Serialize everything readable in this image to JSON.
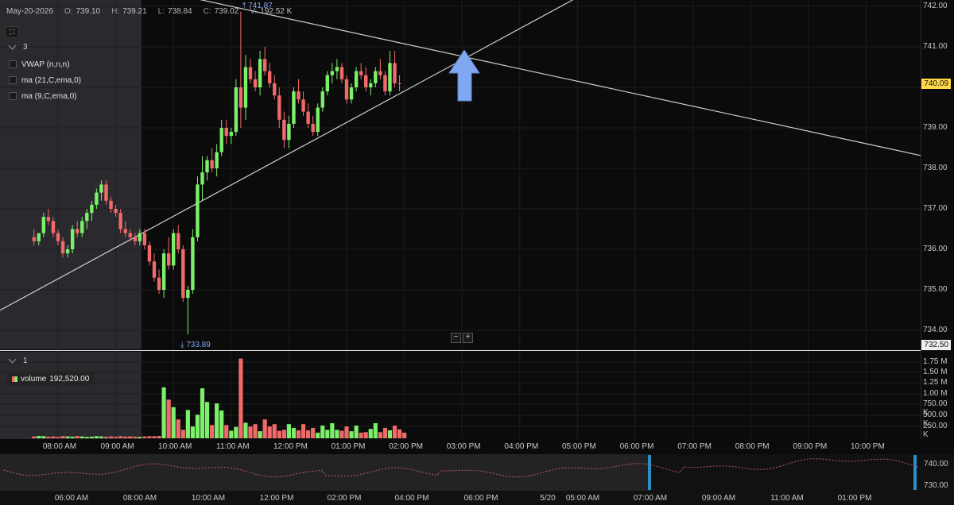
{
  "colors": {
    "up": "#7cf06a",
    "down": "#f06a6a",
    "grid": "#1d1d1d",
    "bg": "#0b0b0b",
    "premarket": "#2a2a2e",
    "arrow": "#7fa8f0",
    "current_price_bg": "#ffd84a"
  },
  "ohlc": {
    "date": "May-20-2026",
    "open_label": "O:",
    "open": "739.10",
    "high_label": "H:",
    "high": "739.21",
    "low_label": "L:",
    "low": "738.84",
    "close_label": "C:",
    "close": "739.02",
    "vol_label": "V:",
    "vol": "192.52 K"
  },
  "main_panel": {
    "collapse_count": "3",
    "indicators": [
      "VWAP (n,n,n)",
      "ma (21,C,ema,0)",
      "ma (9,C,ema,0)"
    ],
    "focus_icon": "fullscreen-icon"
  },
  "volume_panel": {
    "collapse_count": "1",
    "badge_label": "volume",
    "badge_value": "192,520.00"
  },
  "markers": {
    "high": "741.87",
    "low": "733.89"
  },
  "price_axis": {
    "labels": [
      "742.00",
      "741.00",
      "740.00",
      "739.00",
      "738.00",
      "737.00",
      "736.00",
      "735.00",
      "734.00"
    ],
    "current": "740.09",
    "bottom": "732.50"
  },
  "volume_axis": {
    "labels": [
      "1.75 M",
      "1.50 M",
      "1.25 M",
      "1.00 M",
      "750.00 K",
      "500.00 K",
      "250.00 K"
    ]
  },
  "time_axis": {
    "labels": [
      "08:00 AM",
      "09:00 AM",
      "10:00 AM",
      "11:00 AM",
      "12:00 PM",
      "01:00 PM",
      "02:00 PM",
      "03:00 PM",
      "04:00 PM",
      "05:00 PM",
      "06:00 PM",
      "07:00 PM",
      "08:00 PM",
      "09:00 PM",
      "10:00 PM"
    ]
  },
  "navigator": {
    "time_labels": [
      "06:00 AM",
      "08:00 AM",
      "10:00 AM",
      "12:00 PM",
      "02:00 PM",
      "04:00 PM",
      "06:00 PM",
      "5/20",
      "05:00 AM",
      "07:00 AM",
      "09:00 AM",
      "11:00 AM",
      "01:00 PM"
    ],
    "price_labels": [
      "740.00",
      "730.00"
    ]
  },
  "zoom": {
    "minus": "−",
    "plus": "+"
  },
  "chart_data": {
    "type": "candlestick",
    "session_date": "May-20-2026",
    "ylim": [
      733.5,
      742.2
    ],
    "x_range": [
      "07:35 AM",
      "11:00 PM"
    ],
    "bar_interval_minutes": 5,
    "start_time": "07:35 AM",
    "trendlines": [
      {
        "from": {
          "time": "07:35 AM",
          "price": 734.95
        },
        "to": {
          "time": "03:25 PM",
          "price": 741.0
        }
      },
      {
        "from": {
          "time": "11:00 AM",
          "price": 742.0
        },
        "to": {
          "time": "11:00 PM",
          "price": 738.3
        }
      }
    ],
    "candles": [
      [
        736.3,
        736.5,
        736.1,
        736.2
      ],
      [
        736.2,
        736.4,
        736.1,
        736.4
      ],
      [
        736.4,
        736.9,
        736.3,
        736.8
      ],
      [
        736.8,
        737.0,
        736.6,
        736.7
      ],
      [
        736.7,
        736.8,
        736.3,
        736.4
      ],
      [
        736.4,
        736.5,
        736.1,
        736.2
      ],
      [
        736.2,
        736.3,
        735.8,
        735.9
      ],
      [
        735.9,
        736.1,
        735.8,
        736.0
      ],
      [
        736.0,
        736.6,
        735.9,
        736.5
      ],
      [
        736.5,
        736.7,
        736.3,
        736.4
      ],
      [
        736.4,
        736.8,
        736.3,
        736.7
      ],
      [
        736.7,
        737.0,
        736.5,
        736.9
      ],
      [
        736.9,
        737.2,
        736.7,
        737.1
      ],
      [
        737.1,
        737.5,
        737.0,
        737.4
      ],
      [
        737.4,
        737.7,
        737.2,
        737.6
      ],
      [
        737.6,
        737.7,
        737.1,
        737.2
      ],
      [
        737.2,
        737.3,
        736.9,
        737.0
      ],
      [
        737.0,
        737.1,
        736.8,
        736.9
      ],
      [
        736.9,
        737.0,
        736.4,
        736.5
      ],
      [
        736.5,
        736.7,
        736.3,
        736.4
      ],
      [
        736.4,
        736.5,
        736.2,
        736.3
      ],
      [
        736.3,
        736.4,
        736.1,
        736.2
      ],
      [
        736.2,
        736.5,
        736.1,
        736.4
      ],
      [
        736.4,
        736.5,
        736.0,
        736.1
      ],
      [
        736.1,
        736.2,
        735.6,
        735.7
      ],
      [
        735.7,
        735.9,
        735.2,
        735.3
      ],
      [
        735.3,
        735.5,
        734.9,
        735.0
      ],
      [
        735.0,
        736.0,
        734.8,
        735.9
      ],
      [
        735.9,
        736.3,
        735.5,
        735.6
      ],
      [
        735.6,
        736.5,
        735.5,
        736.4
      ],
      [
        736.4,
        736.6,
        735.9,
        736.0
      ],
      [
        736.0,
        736.1,
        734.7,
        734.8
      ],
      [
        734.8,
        735.1,
        733.9,
        735.0
      ],
      [
        735.0,
        736.5,
        734.9,
        736.3
      ],
      [
        736.3,
        737.8,
        736.2,
        737.6
      ],
      [
        737.6,
        738.3,
        737.2,
        737.9
      ],
      [
        737.9,
        738.3,
        737.7,
        738.2
      ],
      [
        738.2,
        738.5,
        737.9,
        738.0
      ],
      [
        738.0,
        738.6,
        737.8,
        738.4
      ],
      [
        738.4,
        739.2,
        738.3,
        739.0
      ],
      [
        739.0,
        739.2,
        738.6,
        738.8
      ],
      [
        738.8,
        739.0,
        738.6,
        738.9
      ],
      [
        738.9,
        740.2,
        738.8,
        740.0
      ],
      [
        740.0,
        741.87,
        739.0,
        739.5
      ],
      [
        739.5,
        740.8,
        739.2,
        740.5
      ],
      [
        740.5,
        740.7,
        740.1,
        740.2
      ],
      [
        740.2,
        740.4,
        739.9,
        740.0
      ],
      [
        740.0,
        740.9,
        739.8,
        740.7
      ],
      [
        740.7,
        741.0,
        740.3,
        740.4
      ],
      [
        740.4,
        740.6,
        740.0,
        740.1
      ],
      [
        740.1,
        740.3,
        739.7,
        739.8
      ],
      [
        739.8,
        740.0,
        739.0,
        739.2
      ],
      [
        739.2,
        739.4,
        738.5,
        738.7
      ],
      [
        738.7,
        739.3,
        738.5,
        739.1
      ],
      [
        739.1,
        740.0,
        739.0,
        739.9
      ],
      [
        739.9,
        740.2,
        739.6,
        739.7
      ],
      [
        739.7,
        739.9,
        739.3,
        739.4
      ],
      [
        739.4,
        739.6,
        739.0,
        739.1
      ],
      [
        739.1,
        739.3,
        738.8,
        738.9
      ],
      [
        738.9,
        739.6,
        738.8,
        739.5
      ],
      [
        739.5,
        740.0,
        739.4,
        739.9
      ],
      [
        739.9,
        740.4,
        739.8,
        740.3
      ],
      [
        740.3,
        740.6,
        740.1,
        740.4
      ],
      [
        740.4,
        740.7,
        740.2,
        740.5
      ],
      [
        740.5,
        740.6,
        740.1,
        740.2
      ],
      [
        740.2,
        740.3,
        739.6,
        739.7
      ],
      [
        739.7,
        740.1,
        739.6,
        740.0
      ],
      [
        740.0,
        740.5,
        739.9,
        740.4
      ],
      [
        740.4,
        740.6,
        740.2,
        740.3
      ],
      [
        740.3,
        740.5,
        739.9,
        740.0
      ],
      [
        740.0,
        740.2,
        739.8,
        740.1
      ],
      [
        740.1,
        740.5,
        740.0,
        740.4
      ],
      [
        740.4,
        740.7,
        740.2,
        740.3
      ],
      [
        740.3,
        740.4,
        739.8,
        739.9
      ],
      [
        739.9,
        740.9,
        739.8,
        740.6
      ],
      [
        740.6,
        740.9,
        740.0,
        740.1
      ],
      [
        740.1,
        740.3,
        739.9,
        740.09
      ]
    ],
    "volume": [
      40,
      50,
      45,
      35,
      40,
      30,
      45,
      40,
      35,
      50,
      40,
      30,
      35,
      45,
      40,
      35,
      40,
      30,
      45,
      35,
      40,
      35,
      30,
      40,
      45,
      45,
      50,
      1080,
      820,
      660,
      400,
      180,
      600,
      250,
      500,
      1060,
      770,
      280,
      740,
      590,
      280,
      160,
      240,
      1690,
      330,
      250,
      300,
      150,
      400,
      250,
      300,
      160,
      180,
      300,
      220,
      170,
      300,
      170,
      220,
      120,
      270,
      180,
      320,
      180,
      160,
      250,
      150,
      270,
      120,
      130,
      200,
      320,
      130,
      220,
      170,
      270,
      190,
      120
    ]
  }
}
